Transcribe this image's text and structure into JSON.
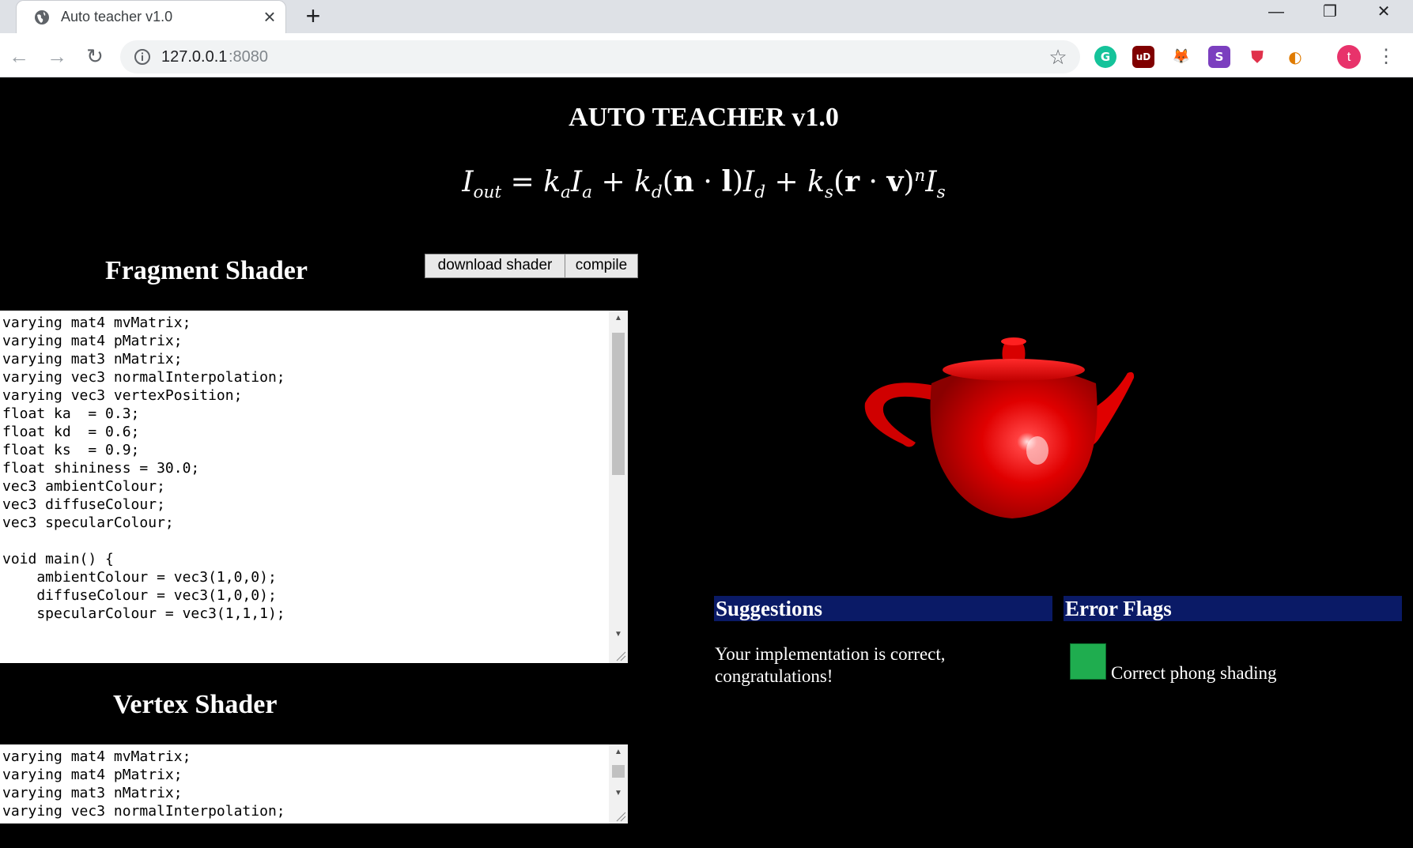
{
  "browser": {
    "tab_title": "Auto teacher v1.0",
    "tab_close": "×",
    "new_tab": "+",
    "window_controls": {
      "minimize": "—",
      "restore": "❐",
      "close": "✕"
    },
    "nav": {
      "back": "←",
      "forward": "→",
      "reload": "↻"
    },
    "url_host": "127.0.0.1",
    "url_port": ":8080",
    "star": "☆",
    "extensions": [
      {
        "name": "grammarly-icon",
        "glyph": "G",
        "color": "#15c39a"
      },
      {
        "name": "ublock-icon",
        "glyph": "uD",
        "color": "#800000"
      },
      {
        "name": "metamask-icon",
        "glyph": "🦊",
        "color": "#ffffff"
      },
      {
        "name": "stylus-icon",
        "glyph": "S",
        "color": "#7b3fbf"
      },
      {
        "name": "pocket-icon",
        "glyph": "⛊",
        "color": "#ffffff"
      },
      {
        "name": "extension-icon",
        "glyph": "◐",
        "color": "#ffffff"
      }
    ],
    "avatar_letter": "t",
    "menu": "⋮"
  },
  "page": {
    "title": "AUTO TEACHER v1.0",
    "formula": {
      "i": "I",
      "out": "out",
      "eq": " = ",
      "k": "k",
      "a": "a",
      "d": "d",
      "s": "s",
      "plus": " + ",
      "n": "n",
      "l": "l",
      "r": "r",
      "v": "v",
      "dot": " · ",
      "lp": "(",
      "rp": ")",
      "exp": "n"
    },
    "fragment_title": "Fragment Shader",
    "download_label": "download shader",
    "compile_label": "compile",
    "fragment_code": "varying mat4 mvMatrix;\nvarying mat4 pMatrix;\nvarying mat3 nMatrix;\nvarying vec3 normalInterpolation;\nvarying vec3 vertexPosition;\nfloat ka  = 0.3;\nfloat kd  = 0.6;\nfloat ks  = 0.9;\nfloat shininess = 30.0;\nvec3 ambientColour;\nvec3 diffuseColour;\nvec3 specularColour;\n\nvoid main() {\n    ambientColour = vec3(1,0,0);\n    diffuseColour = vec3(1,0,0);\n    specularColour = vec3(1,1,1);",
    "vertex_title": "Vertex Shader",
    "vertex_code": "varying mat4 mvMatrix;\nvarying mat4 pMatrix;\nvarying mat3 nMatrix;\nvarying vec3 normalInterpolation;",
    "suggestions_header": "Suggestions",
    "suggestion_text": "Your implementation is correct, congratulations!",
    "error_flags_header": "Error Flags",
    "flag_label": "Correct phong shading",
    "flag_color": "#1fad4f",
    "teapot_color": "#e00000"
  }
}
